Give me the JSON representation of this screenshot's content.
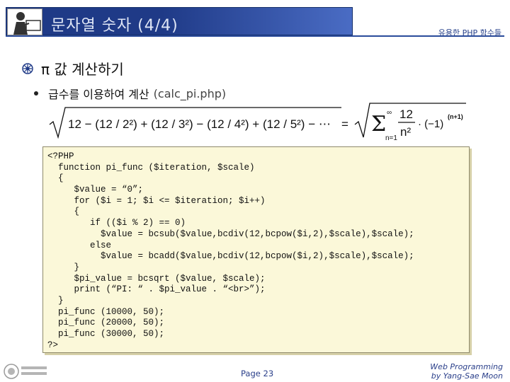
{
  "header": {
    "title": "문자열 숫자 (4/4)",
    "right_caption": "유용한 PHP 함수들"
  },
  "section": {
    "heading": "π 값 계산하기"
  },
  "bullet": {
    "text": "급수를 이용하여 계산",
    "file": "(calc_pi.php)"
  },
  "formula": {
    "left": "12 − (12 / 2²) + (12 / 3²) − (12 / 4²) + (12 / 5²) − ⋯",
    "equals": "=",
    "sum_upper": "∞",
    "sum_lower": "n=1",
    "numerator": "12",
    "denominator": "n²",
    "factor": "· (−1)",
    "exponent": "(n+1)"
  },
  "code_lines": [
    "<?PHP",
    "  function pi_func ($iteration, $scale)",
    "  {",
    "     $value = “0”;",
    "     for ($i = 1; $i <= $iteration; $i++)",
    "     {",
    "        if (($i % 2) == 0)",
    "          $value = bcsub($value,bcdiv(12,bcpow($i,2),$scale),$scale);",
    "        else",
    "          $value = bcadd($value,bcdiv(12,bcpow($i,2),$scale),$scale);",
    "     }",
    "     $pi_value = bcsqrt ($value, $scale);",
    "     print (“PI: “ . $pi_value . “<br>”);",
    "  }",
    "  pi_func (10000, 50);",
    "  pi_func (20000, 50);",
    "  pi_func (30000, 50);",
    "?>"
  ],
  "footer": {
    "page": "Page 23",
    "credit_line1": "Web Programming",
    "credit_line2": "by Yang-Sae Moon"
  }
}
